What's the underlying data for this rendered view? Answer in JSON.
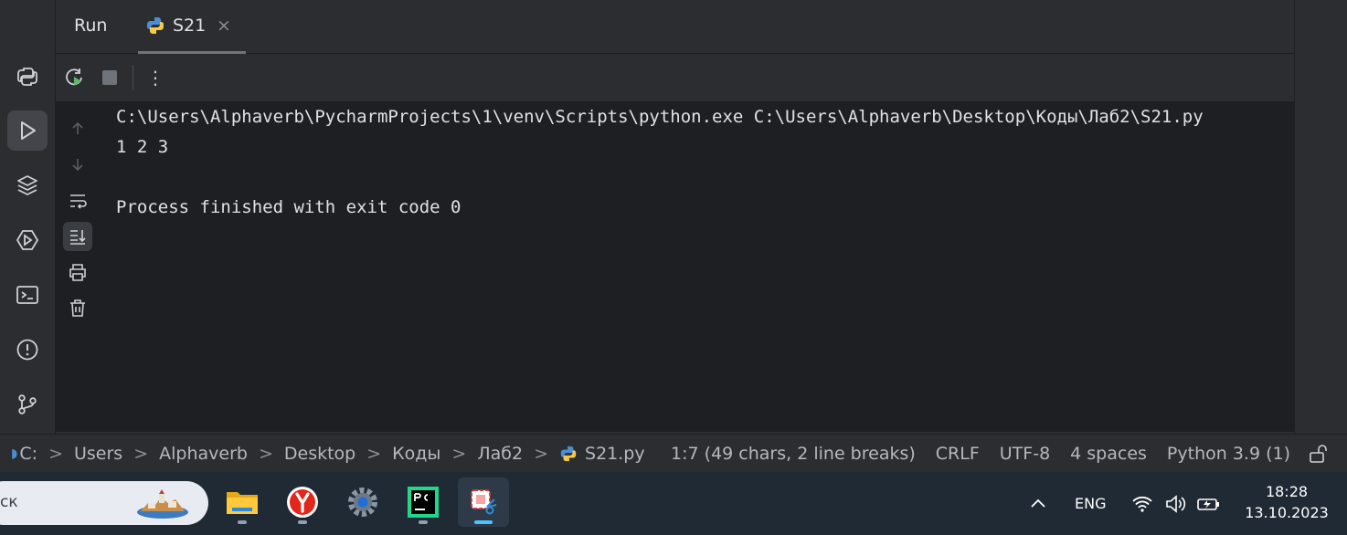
{
  "run_tab": {
    "run_label": "Run",
    "tab_label": "S21",
    "close_glyph": "×"
  },
  "toolbar": {
    "more_glyph": "⋮"
  },
  "console": {
    "lines": [
      "C:\\Users\\Alphaverb\\PycharmProjects\\1\\venv\\Scripts\\python.exe C:\\Users\\Alphaverb\\Desktop\\Коды\\Лаб2\\S21.py",
      "1 2 3",
      "",
      "Process finished with exit code 0"
    ]
  },
  "statusbar": {
    "breadcrumbs": [
      "C:",
      "Users",
      "Alphaverb",
      "Desktop",
      "Коды",
      "Лаб2",
      "S21.py"
    ],
    "position": "1:7 (49 chars, 2 line breaks)",
    "line_sep": "CRLF",
    "encoding": "UTF-8",
    "indent": "4 spaces",
    "interpreter": "Python 3.9 (1)"
  },
  "taskbar": {
    "search_text": "ск",
    "lang": "ENG",
    "time": "18:28",
    "date": "13.10.2023"
  },
  "colors": {
    "accent": "#4cc2ff",
    "console_bg": "#1e1f22",
    "panel_bg": "#2b2d30"
  }
}
